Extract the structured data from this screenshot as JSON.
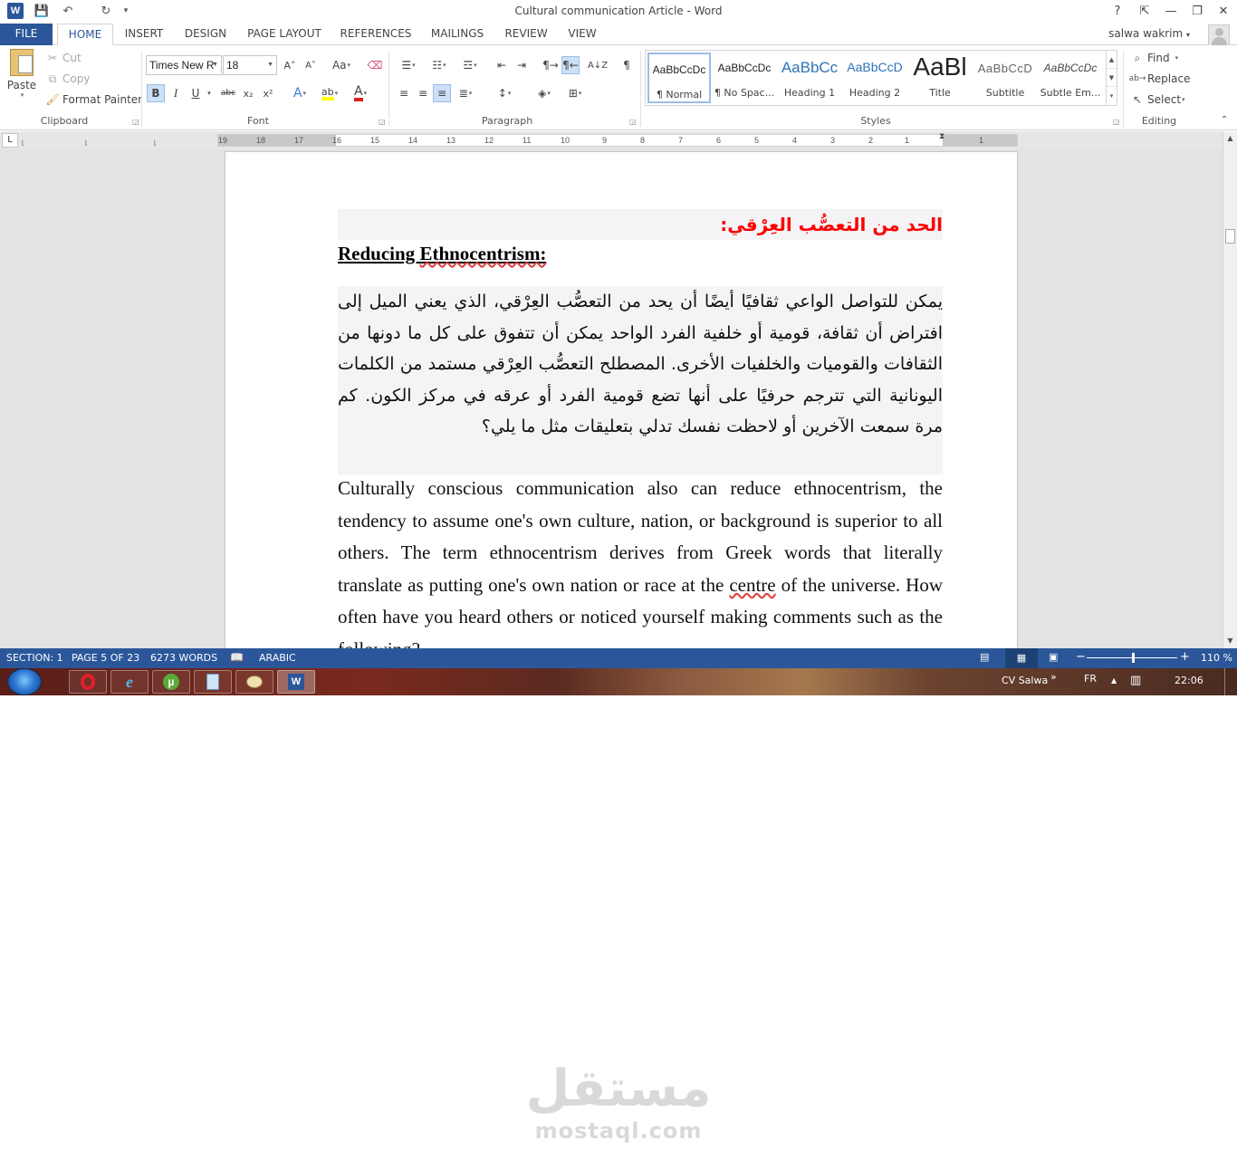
{
  "window": {
    "title": "Cultural communication Article - Word",
    "app_icon": "W",
    "qat": {
      "save_icon": "💾",
      "undo_icon": "↶",
      "redo_icon": "↻",
      "customize_icon": "▾"
    },
    "controls": {
      "help": "?",
      "ribbon_options": "⇱",
      "minimize": "—",
      "restore": "❐",
      "close": "✕"
    }
  },
  "tabs": [
    "FILE",
    "HOME",
    "INSERT",
    "DESIGN",
    "PAGE LAYOUT",
    "REFERENCES",
    "MAILINGS",
    "REVIEW",
    "VIEW"
  ],
  "active_tab": "HOME",
  "user": {
    "name": "salwa wakrim",
    "dropdown": "▾"
  },
  "ribbon": {
    "clipboard": {
      "label": "Clipboard",
      "paste": "Paste",
      "cut": "Cut",
      "copy": "Copy",
      "format_painter": "Format Painter"
    },
    "font": {
      "label": "Font",
      "font_name": "Times New R",
      "font_size": "18",
      "grow": "A˄",
      "shrink": "A˅",
      "change_case": "Aa",
      "clear": "A̸",
      "bold": "B",
      "italic": "I",
      "underline": "U",
      "strike": "abc",
      "subscript": "x₂",
      "superscript": "x²",
      "effects": "A",
      "highlight": "ab",
      "color": "A"
    },
    "paragraph": {
      "label": "Paragraph",
      "show_marks": "¶",
      "sort": "A↓Z"
    },
    "styles": {
      "label": "Styles",
      "tiles": [
        {
          "sample": "AaBbCcDc",
          "name": "¶ Normal"
        },
        {
          "sample": "AaBbCcDc",
          "name": "¶ No Spac..."
        },
        {
          "sample": "AaBbCc",
          "name": "Heading 1"
        },
        {
          "sample": "AaBbCcD",
          "name": "Heading 2"
        },
        {
          "sample": "AaBl",
          "name": "Title"
        },
        {
          "sample": "AaBbCcD",
          "name": "Subtitle"
        },
        {
          "sample": "AaBbCcDc",
          "name": "Subtle Em..."
        }
      ]
    },
    "editing": {
      "label": "Editing",
      "find": "Find",
      "replace": "Replace",
      "select": "Select"
    }
  },
  "ruler": {
    "tab_selector": "L",
    "numbers": [
      "19",
      "18",
      "17",
      "16",
      "15",
      "14",
      "13",
      "12",
      "11",
      "10",
      "9",
      "8",
      "7",
      "6",
      "5",
      "4",
      "3",
      "2",
      "1",
      "1"
    ]
  },
  "document": {
    "arabic_heading": "الحد من التعصُّب العِرْقي:",
    "english_heading_main": "Reducing ",
    "english_heading_squiggle": "Ethnocentrism:",
    "arabic_paragraph": "يمكن للتواصل الواعي ثقافيًا أيضًا أن يحد من التعصُّب العِرْقي، الذي يعني الميل إلى افتراض أن ثقافة، قومية أو خلفية الفرد الواحد يمكن أن تتفوق على كل ما دونها من الثقافات والقوميات والخلفيات الأخرى. المصطلح التعصُّب العِرْقي مستمد من الكلمات اليونانية التي تترجم حرفيًا على أنها تضع قومية الفرد أو عرقه في مركز الكون. كم مرة سمعت الآخرين أو لاحظت نفسك تدلي بتعليقات مثل ما يلي؟",
    "english_paragraph_before": "Culturally conscious communication also can reduce ethnocentrism, the tendency to assume one's own culture, nation, or background is superior to all others. The term ethnocentrism derives from Greek words that literally translate as putting one's own nation or race at the ",
    "english_paragraph_squiggle": "centre",
    "english_paragraph_after": " of the universe. How often have you heard others or noticed yourself making comments such as the following?"
  },
  "status": {
    "section": "SECTION: 1",
    "page": "PAGE 5 OF 23",
    "words": "6273 WORDS",
    "language": "ARABIC",
    "zoom": "110 %",
    "zoom_level_percent": 110
  },
  "taskbar": {
    "items": [
      "opera",
      "internet-explorer",
      "utorrent",
      "notepad",
      "paint",
      "word"
    ],
    "tray_user": "CV Salwa",
    "tray_chevron": "»",
    "language": "FR",
    "show_hidden": "▲",
    "clock": "22:06"
  },
  "watermark": {
    "arabic": "مستقل",
    "latin": "mostaql.com"
  },
  "colors": {
    "accent": "#2b579a",
    "heading_red": "#ff0000",
    "highlight_bg": "#f4f4f6"
  }
}
